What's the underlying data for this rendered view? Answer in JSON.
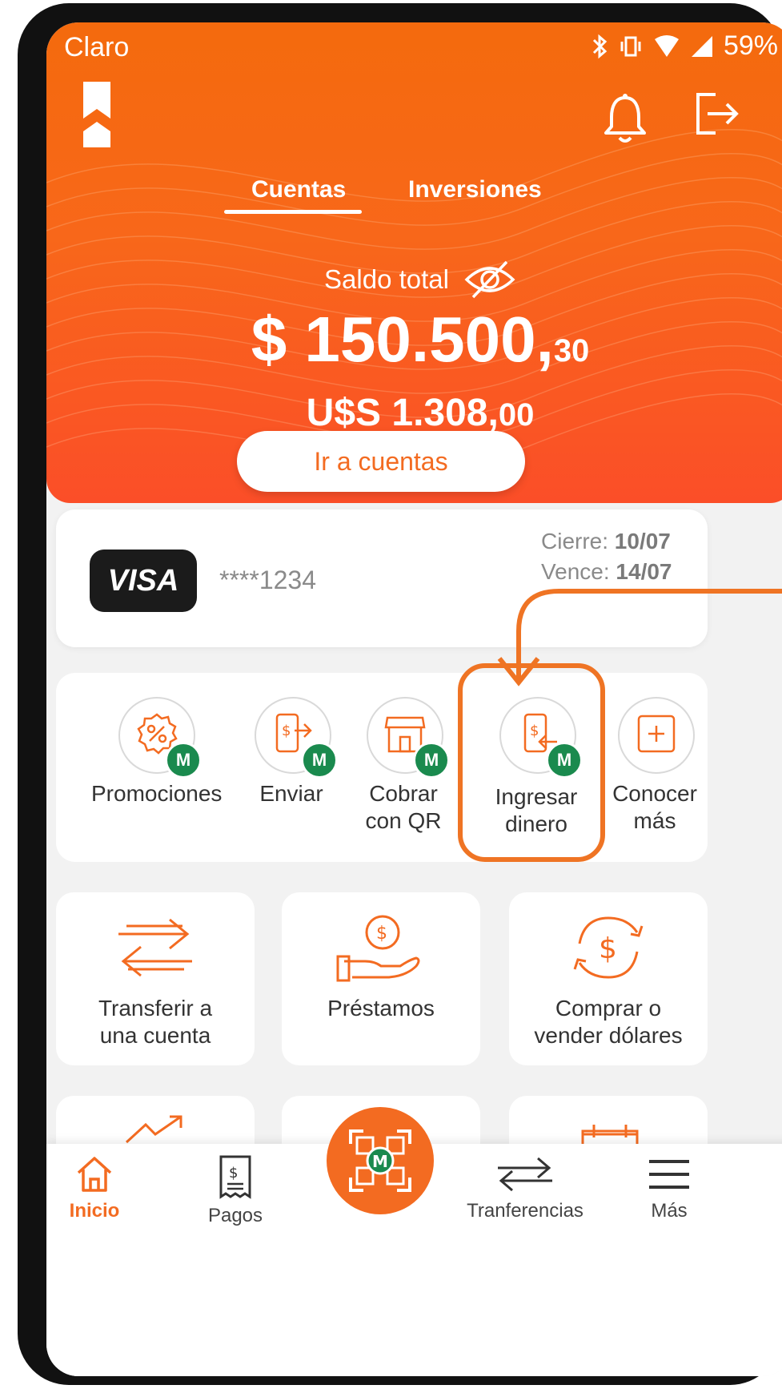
{
  "statusbar": {
    "carrier": "Claro",
    "battery": "59%"
  },
  "header": {
    "tabs": [
      {
        "label": "Cuentas",
        "active": true
      },
      {
        "label": "Inversiones",
        "active": false
      }
    ],
    "balance_label": "Saldo total",
    "balance_main": "$ 150.500,",
    "balance_cents": "30",
    "usd_main": "U$S 1.308,",
    "usd_cents": "00",
    "go_accounts": "Ir a cuentas"
  },
  "card": {
    "brand": "VISA",
    "masked_number": "****1234",
    "closing_label": "Cierre:",
    "closing_value": "10/07",
    "due_label": "Vence:",
    "due_value": "14/07"
  },
  "quick_actions": [
    {
      "label": "Promociones",
      "icon": "promo-percent-icon",
      "badge": "M"
    },
    {
      "label": "Enviar",
      "icon": "send-money-phone-icon",
      "badge": "M"
    },
    {
      "label": "Cobrar con QR",
      "icon": "storefront-icon",
      "badge": "M"
    },
    {
      "label": "Ingresar dinero",
      "icon": "receive-money-phone-icon",
      "badge": "M",
      "highlighted": true
    },
    {
      "label": "Conocer más",
      "icon": "plus-square-icon"
    }
  ],
  "tiles": [
    {
      "label": "Transferir a una cuenta",
      "icon": "transfer-arrows-icon"
    },
    {
      "label": "Préstamos",
      "icon": "loan-hand-coin-icon"
    },
    {
      "label": "Comprar o vender dólares",
      "icon": "currency-exchange-icon"
    }
  ],
  "bottom_nav": [
    {
      "label": "Inicio",
      "icon": "home-icon",
      "active": true
    },
    {
      "label": "Pagos",
      "icon": "receipt-icon"
    },
    {
      "label": "",
      "icon": "qr-scan-icon"
    },
    {
      "label": "Tranferencias",
      "icon": "transfer-icon"
    },
    {
      "label": "Más",
      "icon": "menu-icon"
    }
  ],
  "colors": {
    "brand_orange": "#f36b21",
    "badge_green": "#1a8a4e"
  }
}
